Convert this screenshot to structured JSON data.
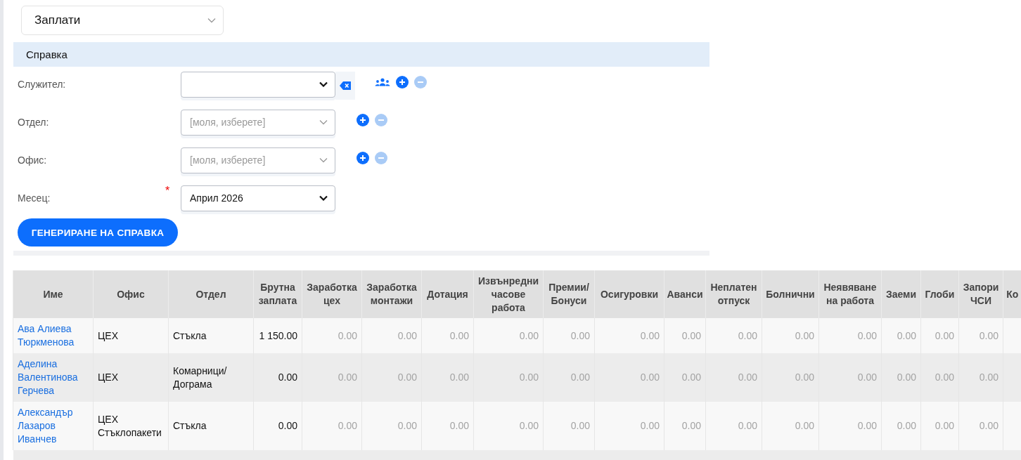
{
  "module_select": {
    "value": "Заплати"
  },
  "section": {
    "title": "Справка"
  },
  "fields": [
    {
      "label": "Служител:",
      "kind": "native",
      "clearable": true,
      "actions": [
        {
          "kind": "group",
          "disabled": false
        },
        {
          "kind": "add",
          "disabled": false
        },
        {
          "kind": "remove",
          "disabled": true
        }
      ]
    },
    {
      "label": "Отдел:",
      "kind": "picker",
      "placeholder": "[моля, изберете]",
      "actions": [
        {
          "kind": "add",
          "disabled": false
        },
        {
          "kind": "remove",
          "disabled": true
        }
      ]
    },
    {
      "label": "Офис:",
      "kind": "picker",
      "placeholder": "[моля, изберете]",
      "actions": [
        {
          "kind": "add",
          "disabled": false
        },
        {
          "kind": "remove",
          "disabled": true
        }
      ]
    },
    {
      "label": "Месец:",
      "kind": "native",
      "value": "Април 2026",
      "required_mark": "*"
    }
  ],
  "generate_button": "ГЕНЕРИРАНЕ НА СПРАВКА",
  "table": {
    "columns": [
      "Име",
      "Офис",
      "Отдел",
      "Брутна заплата",
      "Заработка цех",
      "Заработка монтажи",
      "Дотация",
      "Извънредни часове работа",
      "Премии/ Бонуси",
      "Осигуровки",
      "Аванси",
      "Неплатен отпуск",
      "Болнични",
      "Неявяване на работа",
      "Заеми",
      "Глоби",
      "Запори ЧСИ",
      "Ко"
    ],
    "rows": [
      {
        "name": "Ава Алиева Тюркменова",
        "office": "ЦЕХ",
        "department": "Стъкла",
        "gross": "1 150.00",
        "values": [
          "0.00",
          "0.00",
          "0.00",
          "0.00",
          "0.00",
          "0.00",
          "0.00",
          "0.00",
          "0.00",
          "0.00",
          "0.00",
          "0.00",
          "0.00"
        ]
      },
      {
        "name": "Аделина Валентинова Герчева",
        "office": "ЦЕХ",
        "department": "Комарници/ Дограма",
        "gross": "0.00",
        "values": [
          "0.00",
          "0.00",
          "0.00",
          "0.00",
          "0.00",
          "0.00",
          "0.00",
          "0.00",
          "0.00",
          "0.00",
          "0.00",
          "0.00",
          "0.00"
        ]
      },
      {
        "name": "Александър Лазаров Иванчев",
        "office": "ЦЕХ Стъклопакети",
        "department": "Стъкла",
        "gross": "0.00",
        "values": [
          "0.00",
          "0.00",
          "0.00",
          "0.00",
          "0.00",
          "0.00",
          "0.00",
          "0.00",
          "0.00",
          "0.00",
          "0.00",
          "0.00",
          "0.00"
        ]
      }
    ]
  }
}
